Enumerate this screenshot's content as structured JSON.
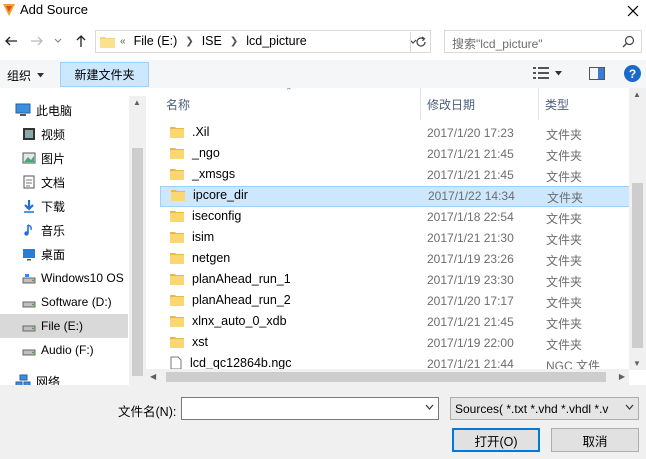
{
  "window": {
    "title": "Add Source",
    "close_icon": "close-icon"
  },
  "nav": {
    "breadcrumbs": [
      "File (E:)",
      "ISE",
      "lcd_picture"
    ],
    "crumb_prefix": "«",
    "search_placeholder": "搜索\"lcd_picture\""
  },
  "toolbar": {
    "organize_label": "组织",
    "new_folder_label": "新建文件夹"
  },
  "sidebar": {
    "items": [
      {
        "label": "此电脑",
        "icon": "computer-icon"
      },
      {
        "label": "视频",
        "icon": "video-icon"
      },
      {
        "label": "图片",
        "icon": "picture-icon"
      },
      {
        "label": "文档",
        "icon": "document-icon"
      },
      {
        "label": "下载",
        "icon": "download-icon"
      },
      {
        "label": "音乐",
        "icon": "music-icon"
      },
      {
        "label": "桌面",
        "icon": "desktop-icon"
      },
      {
        "label": "Windows10 OS",
        "icon": "drive-icon"
      },
      {
        "label": "Software (D:)",
        "icon": "drive-icon"
      },
      {
        "label": "File (E:)",
        "icon": "drive-icon"
      },
      {
        "label": "Audio (F:)",
        "icon": "drive-icon"
      },
      {
        "label": "网络",
        "icon": "network-icon"
      }
    ],
    "selected_index": 9
  },
  "files": {
    "columns": {
      "name": "名称",
      "date": "修改日期",
      "type": "类型"
    },
    "rows": [
      {
        "name": ".Xil",
        "date": "2017/1/20 17:23",
        "type": "文件夹",
        "icon": "folder-icon"
      },
      {
        "name": "_ngo",
        "date": "2017/1/21 21:45",
        "type": "文件夹",
        "icon": "folder-icon"
      },
      {
        "name": "_xmsgs",
        "date": "2017/1/21 21:45",
        "type": "文件夹",
        "icon": "folder-icon"
      },
      {
        "name": "ipcore_dir",
        "date": "2017/1/22 14:34",
        "type": "文件夹",
        "icon": "folder-icon"
      },
      {
        "name": "iseconfig",
        "date": "2017/1/18 22:54",
        "type": "文件夹",
        "icon": "folder-icon"
      },
      {
        "name": "isim",
        "date": "2017/1/21 21:30",
        "type": "文件夹",
        "icon": "folder-icon"
      },
      {
        "name": "netgen",
        "date": "2017/1/19 23:26",
        "type": "文件夹",
        "icon": "folder-icon"
      },
      {
        "name": "planAhead_run_1",
        "date": "2017/1/19 23:30",
        "type": "文件夹",
        "icon": "folder-icon"
      },
      {
        "name": "planAhead_run_2",
        "date": "2017/1/20 17:17",
        "type": "文件夹",
        "icon": "folder-icon"
      },
      {
        "name": "xlnx_auto_0_xdb",
        "date": "2017/1/21 21:45",
        "type": "文件夹",
        "icon": "folder-icon"
      },
      {
        "name": "xst",
        "date": "2017/1/19 22:00",
        "type": "文件夹",
        "icon": "folder-icon"
      },
      {
        "name": "lcd_qc12864b.ngc",
        "date": "2017/1/21 21:44",
        "type": "NGC 文件",
        "icon": "file-icon"
      }
    ],
    "selected_index": 3
  },
  "bottom": {
    "filename_label": "文件名(N):",
    "filename_value": "",
    "filter_value": "Sources( *.txt *.vhd *.vhdl *.v",
    "open_label": "打开(O)",
    "cancel_label": "取消"
  }
}
